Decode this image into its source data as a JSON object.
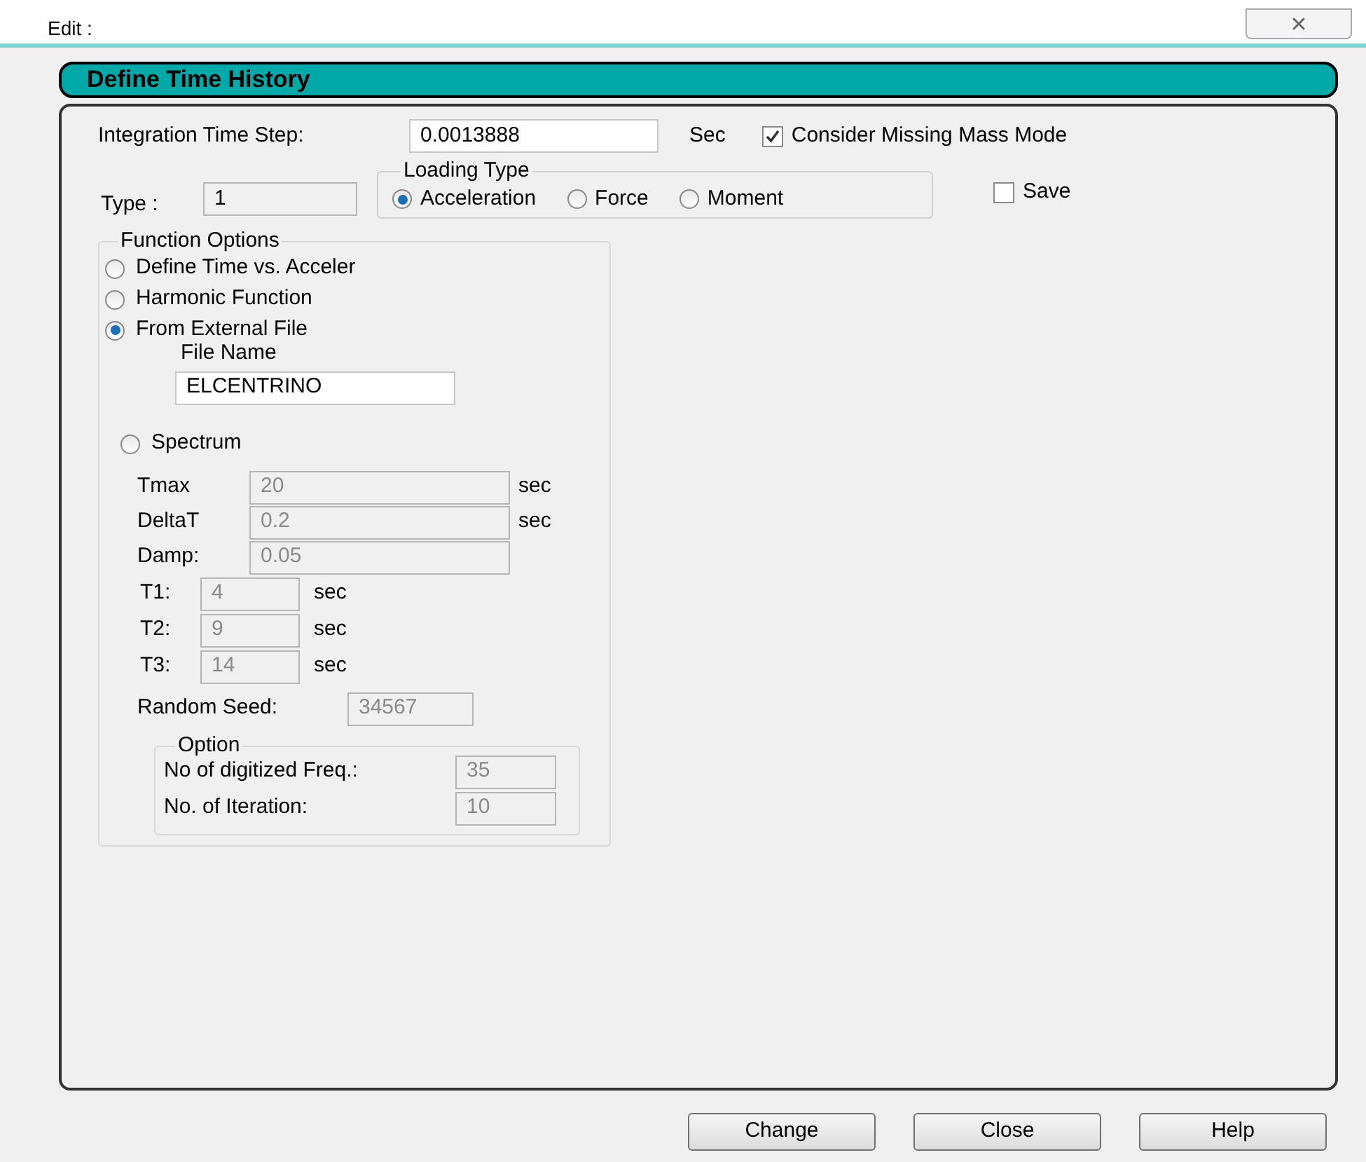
{
  "window": {
    "title": "Edit :"
  },
  "section_title": "Define Time History",
  "integration_time_step": {
    "label": "Integration Time Step:",
    "value": "0.0013888",
    "unit": "Sec"
  },
  "missing_mass": {
    "label": "Consider Missing Mass Mode",
    "checked": true
  },
  "type": {
    "label": "Type :",
    "value": "1"
  },
  "loading_type": {
    "title": "Loading Type",
    "options": [
      {
        "label": "Acceleration",
        "selected": true
      },
      {
        "label": "Force",
        "selected": false
      },
      {
        "label": "Moment",
        "selected": false
      }
    ]
  },
  "save": {
    "label": "Save",
    "checked": false
  },
  "function_options": {
    "title": "Function Options",
    "options": [
      {
        "label": "Define Time vs. Acceler",
        "selected": false
      },
      {
        "label": "Harmonic Function",
        "selected": false
      },
      {
        "label": "From External File",
        "selected": true
      }
    ],
    "file_name": {
      "label": "File Name",
      "value": "ELCENTRINO"
    },
    "spectrum": {
      "label": "Spectrum",
      "selected": false
    },
    "spectrum_fields": [
      {
        "label": "Tmax",
        "value": "20",
        "unit": "sec",
        "kind": "wide",
        "disabled": true
      },
      {
        "label": "DeltaT",
        "value": "0.2",
        "unit": "sec",
        "kind": "wide",
        "disabled": true
      },
      {
        "label": "Damp:",
        "value": "0.05",
        "kind": "wide",
        "disabled": true
      },
      {
        "label": "T1:",
        "value": "4",
        "unit": "sec",
        "kind": "short",
        "disabled": true
      },
      {
        "label": "T2:",
        "value": "9",
        "unit": "sec",
        "kind": "short",
        "disabled": true
      },
      {
        "label": "T3:",
        "value": "14",
        "unit": "sec",
        "kind": "short",
        "disabled": true
      }
    ],
    "random_seed": {
      "label": "Random Seed:",
      "value": "34567",
      "disabled": true
    },
    "option": {
      "title": "Option",
      "fields": [
        {
          "label": "No of digitized Freq.:",
          "value": "35",
          "disabled": true
        },
        {
          "label": "No. of Iteration:",
          "value": "10",
          "disabled": true
        }
      ]
    }
  },
  "buttons": [
    "Change",
    "Close",
    "Help"
  ]
}
